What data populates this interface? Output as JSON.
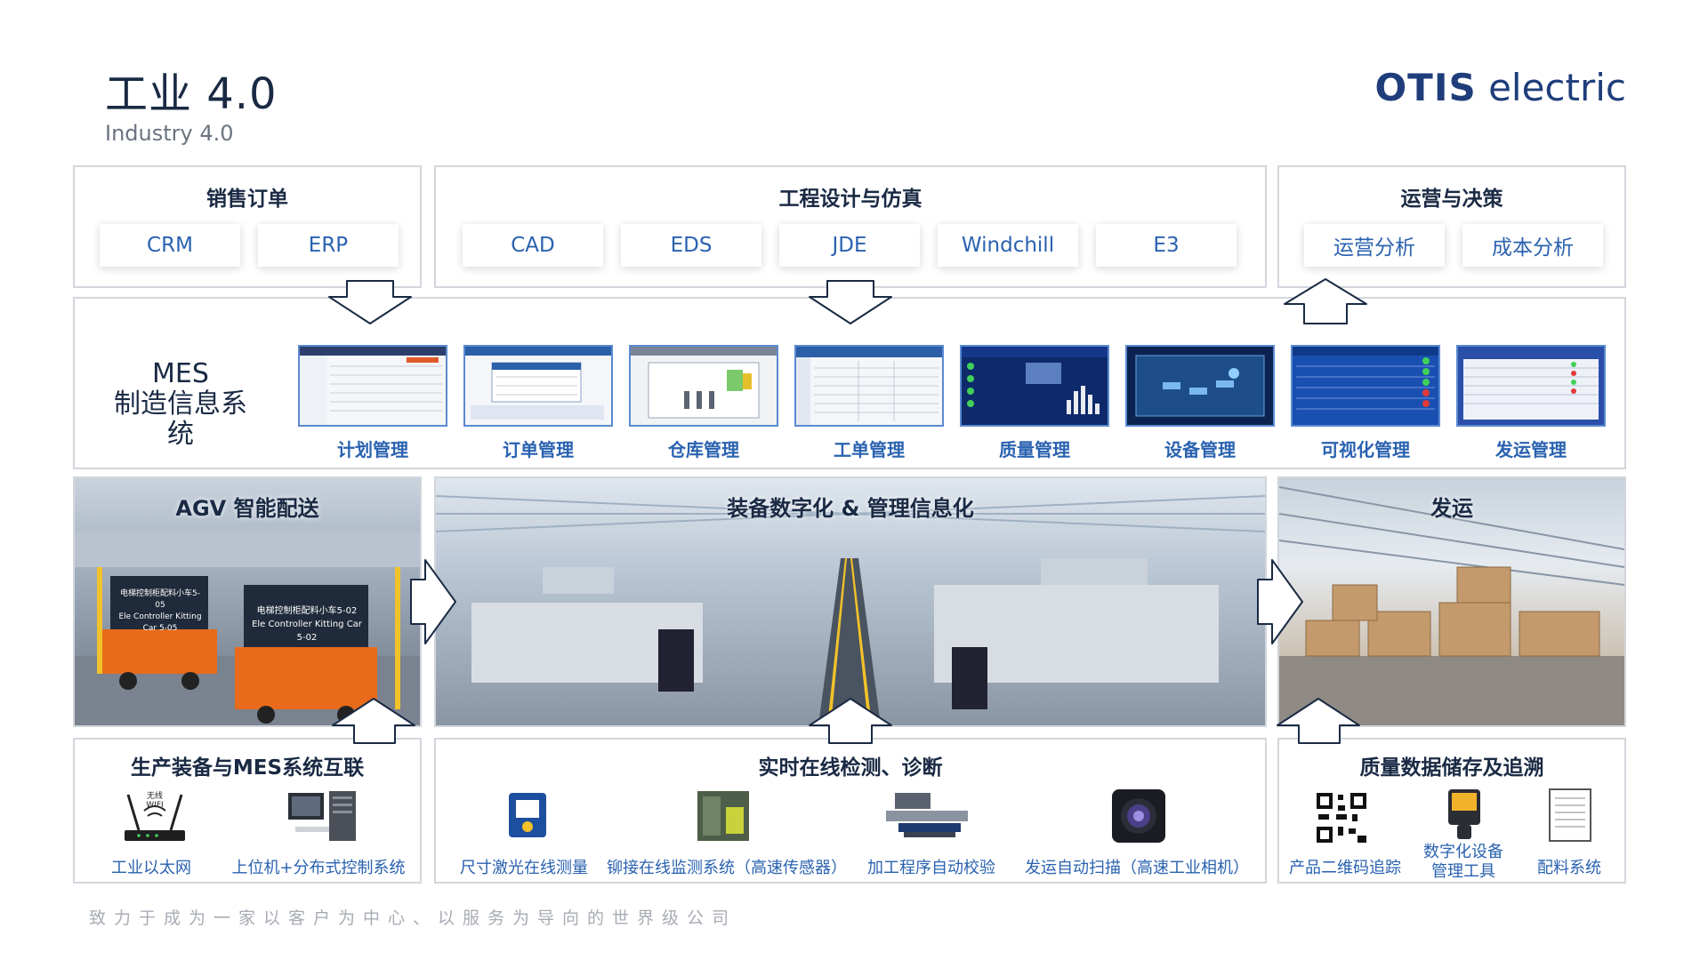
{
  "header": {
    "title": "工业 4.0",
    "subtitle": "Industry 4.0",
    "brand_bold": "OTIS",
    "brand_light": "electric"
  },
  "top": {
    "sales": {
      "title": "销售订单",
      "items": [
        "CRM",
        "ERP"
      ]
    },
    "engineering": {
      "title": "工程设计与仿真",
      "items": [
        "CAD",
        "EDS",
        "JDE",
        "Windchill",
        "E3"
      ]
    },
    "operations": {
      "title": "运营与决策",
      "items": [
        "运营分析",
        "成本分析"
      ]
    }
  },
  "mes": {
    "title_en": "MES",
    "title_cn": "制造信息系统",
    "modules": [
      "计划管理",
      "订单管理",
      "仓库管理",
      "工单管理",
      "质量管理",
      "设备管理",
      "可视化管理",
      "发运管理"
    ]
  },
  "photos": {
    "agv": {
      "title": "AGV 智能配送",
      "cart1_cn": "电梯控制柜配料小车5-05",
      "cart1_en": "Ele Controller Kitting Car 5-05",
      "cart2_cn": "电梯控制柜配料小车5-02",
      "cart2_en": "Ele Controller Kitting Car 5-02"
    },
    "digital": {
      "title": "装备数字化 & 管理信息化"
    },
    "shipping": {
      "title": "发运"
    }
  },
  "bottom": {
    "network": {
      "title": "生产装备与MES系统互联",
      "items": [
        "工业以太网",
        "上位机+分布式控制系统"
      ],
      "router_text": "无线WIFI"
    },
    "inspection": {
      "title": "实时在线检测、诊断",
      "items": [
        "尺寸激光在线测量",
        "铆接在线监测系统（高速传感器）",
        "加工程序自动校验",
        "发运自动扫描（高速工业相机）"
      ]
    },
    "quality": {
      "title": "质量数据储存及追溯",
      "items": [
        "产品二维码追踪",
        "数字化设备",
        "管理工具",
        "配料系统"
      ]
    }
  },
  "footer": {
    "slogan": "致力于成为一家以客户为中心、以服务为导向的世界级公司"
  },
  "colors": {
    "accent": "#2a62b0",
    "border": "#d2d6dc",
    "navy": "#1a2a44"
  }
}
